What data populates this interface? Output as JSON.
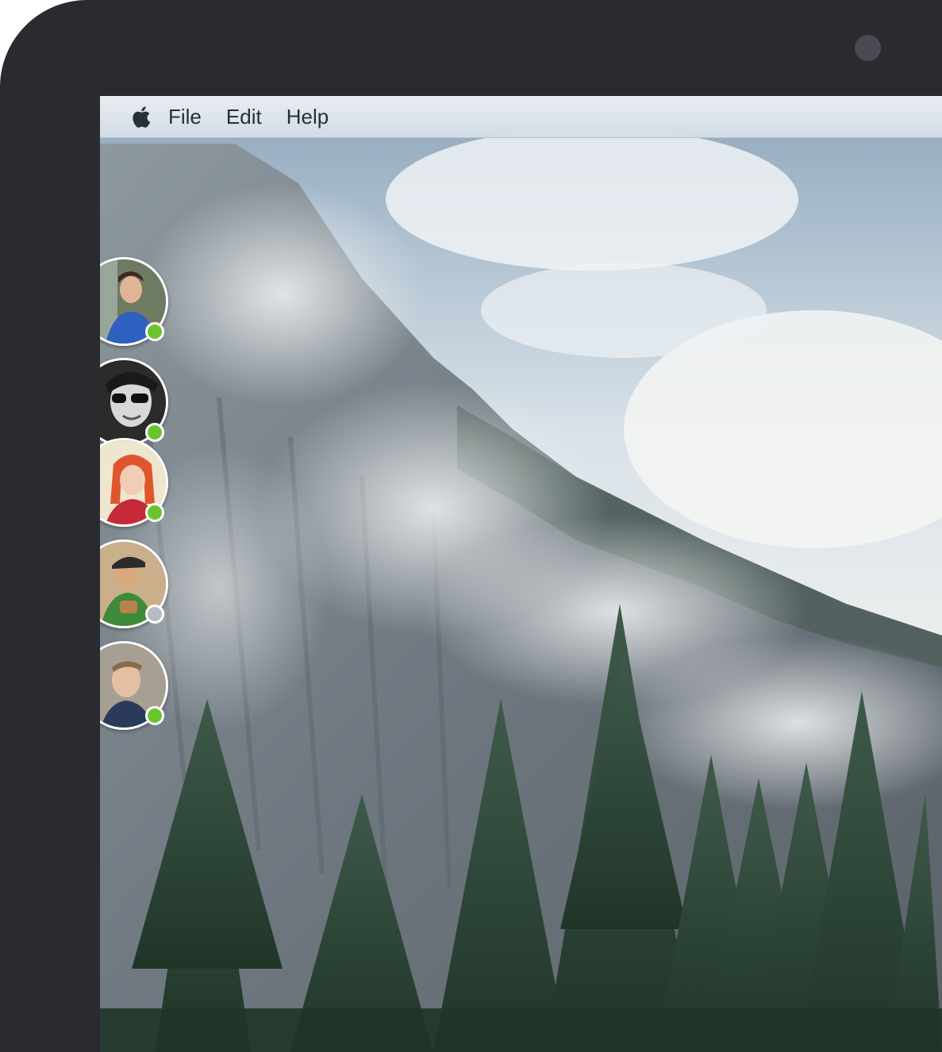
{
  "menubar": {
    "apple_icon": "apple-logo-icon",
    "items": [
      "File",
      "Edit",
      "Help"
    ]
  },
  "friends": [
    {
      "avatar_icon": "user-avatar-icon",
      "status": "online",
      "status_color": "#6ac42e"
    },
    {
      "avatar_icon": "user-avatar-icon",
      "status": "online",
      "status_color": "#6ac42e"
    },
    {
      "avatar_icon": "user-avatar-icon",
      "status": "online",
      "status_color": "#6ac42e"
    },
    {
      "avatar_icon": "user-avatar-icon",
      "status": "offline",
      "status_color": "#b9bcbf"
    },
    {
      "avatar_icon": "user-avatar-icon",
      "status": "online",
      "status_color": "#6ac42e"
    }
  ],
  "colors": {
    "device_bezel": "#2a2b30",
    "camera": "#4a4b52",
    "menu_text": "#2a2f35",
    "online": "#6ac42e",
    "offline": "#b9bcbf"
  }
}
